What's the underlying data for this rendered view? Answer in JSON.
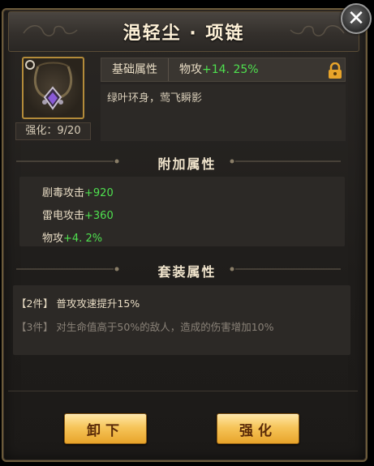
{
  "title": "浥轻尘 · 项链",
  "item": {
    "icon": "necklace-icon",
    "strengthen_label": "强化：9/20"
  },
  "base_attr": {
    "label": "基础属性",
    "stat_name": "物攻",
    "stat_value": "+14. 25%",
    "lock_icon": "lock-icon"
  },
  "description": "绿叶环身，莺飞瞬影",
  "extra_attrs": {
    "title": "附加属性",
    "rows": [
      {
        "name": "剧毒攻击",
        "value": "+920"
      },
      {
        "name": "雷电攻击",
        "value": "+360"
      },
      {
        "name": "物攻",
        "value": "+4. 2%"
      }
    ]
  },
  "set_attrs": {
    "title": "套装属性",
    "rows": [
      {
        "text": "【2件】 普攻攻速提升15%",
        "active": true
      },
      {
        "text": "【3件】 对生命值高于50%的敌人，造成的伤害增加10%",
        "active": false
      }
    ]
  },
  "buttons": {
    "unequip": "卸下",
    "strengthen": "强化"
  },
  "colors": {
    "green_stat": "#4fe04f",
    "button_gold": "#f6c55a",
    "frame_gold": "#b38b3a"
  }
}
